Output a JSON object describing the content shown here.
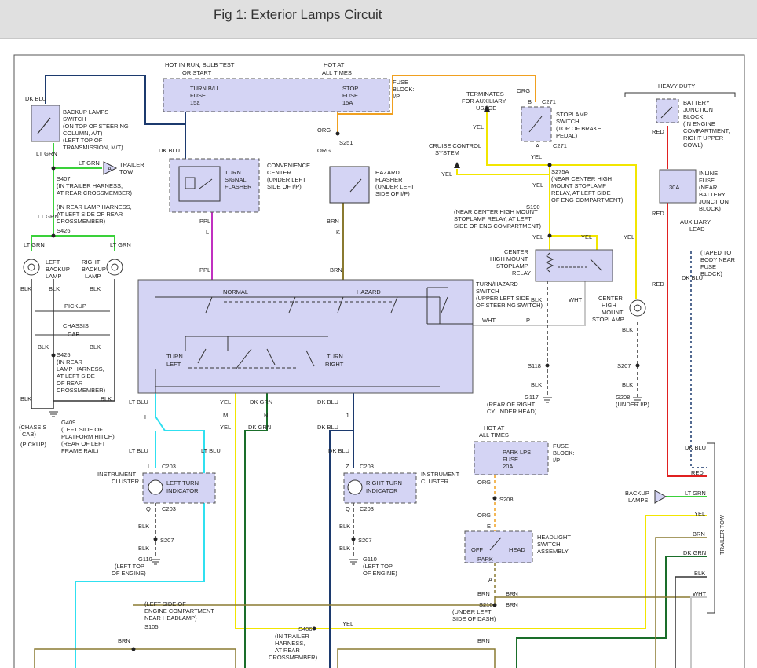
{
  "header": {
    "title": "Fig 1: Exterior Lamps Circuit"
  },
  "labels": {
    "hot_run": [
      "HOT IN RUN, BULB TEST",
      "OR START"
    ],
    "hot_all": [
      "HOT AT",
      "ALL TIMES"
    ],
    "fuse_block_ip": [
      "FUSE",
      "BLOCK:",
      "I/P"
    ],
    "turn_bu_fuse": [
      "TURN B/U",
      "FUSE",
      "15a"
    ],
    "stop_fuse": [
      "STOP",
      "FUSE",
      "15A"
    ],
    "dk_blu": "DK BLU",
    "backup_switch": [
      "BACKUP LAMPS",
      "SWITCH",
      "(ON TOP OF STEERING",
      "COLUMN, A/T)",
      "(LEFT TOP OF",
      "TRANSMISSION, M/T)"
    ],
    "lt_grn": "LT GRN",
    "trailer_tow_label": [
      "TRAILER",
      "TOW"
    ],
    "s407": [
      "S407",
      "(IN TRAILER HARNESS,",
      "AT REAR CROSSMEMBER)"
    ],
    "rear_lamp_harness": [
      "(IN REAR LAMP HARNESS,",
      "AT LEFT SIDE OF REAR",
      "CROSSMEMBER)",
      "S426"
    ],
    "left_backup_lamp": [
      "LEFT",
      "BACKUP",
      "LAMP"
    ],
    "right_backup_lamp": [
      "RIGHT",
      "BACKUP",
      "LAMP"
    ],
    "blk": "BLK",
    "pickup": "PICKUP",
    "chassis_cab": [
      "CHASSIS",
      "CAB"
    ],
    "s425": [
      "S425",
      "(IN REAR",
      "LAMP HARNESS,",
      "AT LEFT SIDE",
      "OF REAR",
      "CROSSMEMBER)"
    ],
    "g409": [
      "G409",
      "(LEFT SIDE OF",
      "PLATFORM HITCH)",
      "(REAR OF LEFT",
      "FRAME RAIL)"
    ],
    "chassis_cab_paren": [
      "(CHASSIS",
      "CAB)"
    ],
    "pickup_paren": "(PICKUP)",
    "convenience_center": [
      "CONVENIENCE",
      "CENTER",
      "(UNDER LEFT",
      "SIDE OF I/P)"
    ],
    "turn_signal_flasher": [
      "TURN",
      "SIGNAL",
      "FLASHER"
    ],
    "hazard_flasher": [
      "HAZARD",
      "FLASHER",
      "(UNDER LEFT",
      "SIDE OF I/P)"
    ],
    "org": "ORG",
    "s251": "S251",
    "brn": "BRN",
    "ppl": "PPL",
    "l_conn": "L",
    "k_conn": "K",
    "normal": "NORMAL",
    "hazard": "HAZARD",
    "turn_left": [
      "TURN",
      "LEFT"
    ],
    "turn_right": [
      "TURN",
      "RIGHT"
    ],
    "turn_hazard_switch": [
      "TURN/HAZARD",
      "SWITCH",
      "(UPPER LEFT SIDE",
      "OF STEERING SWITCH)"
    ],
    "wht": "WHT",
    "p_conn": "P",
    "terminates": [
      "TERMINATES",
      "FOR AUXILIARY",
      "USAGE"
    ],
    "cruise_control": [
      "CRUISE CONTROL",
      "SYSTEM"
    ],
    "yel": "YEL",
    "c271": "C271",
    "b_conn": "B",
    "a_conn": "A",
    "stoplamp_switch": [
      "STOPLAMP",
      "SWITCH",
      "(TOP OF BRAKE",
      "PEDAL)"
    ],
    "s275a": [
      "S275A",
      "(NEAR CENTER HIGH",
      "MOUNT STOPLAMP",
      "RELAY, AT LEFT SIDE",
      "OF ENG COMPARTMENT)"
    ],
    "s190": [
      "S190",
      "(NEAR CENTER HIGH MOUNT",
      "STOPLAMP RELAY, AT LEFT",
      "SIDE OF ENG COMPARTMENT)"
    ],
    "chms_relay": [
      "CENTER",
      "HIGH MOUNT",
      "STOPLAMP",
      "RELAY"
    ],
    "chms_lamp": [
      "CENTER",
      "HIGH",
      "MOUNT",
      "STOPLAMP"
    ],
    "s118": "S118",
    "s207": "S207",
    "g117": [
      "G117",
      "(REAR OF RIGHT",
      "CYLINDER HEAD)"
    ],
    "g208": [
      "G208",
      "(UNDER I/P)"
    ],
    "heavy_duty": "HEAVY DUTY",
    "battery_junction": [
      "BATTERY",
      "JUNCTION",
      "BLOCK",
      "(IN ENGINE",
      "COMPARTMENT,",
      "RIGHT UPPER",
      "COWL)"
    ],
    "red": "RED",
    "inline_fuse": [
      "INLINE",
      "FUSE",
      "(NEAR",
      "BATTERY",
      "JUNCTION",
      "BLOCK)"
    ],
    "fuse_30a": "30A",
    "aux_lead": [
      "AUXILIARY",
      "LEAD",
      "(TAPED TO",
      "BODY NEAR",
      "FUSE",
      "BLOCK)"
    ],
    "lt_blu": "LT BLU",
    "yel_m": "M",
    "dk_grn": "DK GRN",
    "h_conn": "H",
    "n_conn": "N",
    "j_conn": "J",
    "c203": "C203",
    "z_conn": "Z",
    "q_conn": "Q",
    "instrument_cluster": [
      "INSTRUMENT",
      "CLUSTER"
    ],
    "left_turn_ind": [
      "LEFT TURN",
      "INDICATOR"
    ],
    "right_turn_ind": [
      "RIGHT TURN",
      "INDICATOR"
    ],
    "g110": [
      "G110",
      "(LEFT TOP",
      "OF ENGINE)"
    ],
    "park_lps_fuse": [
      "PARK LPS",
      "FUSE",
      "20A"
    ],
    "s208": "S208",
    "e_conn": "E",
    "headlight_switch": [
      "HEADLIGHT",
      "SWITCH",
      "ASSEMBLY"
    ],
    "off": "OFF",
    "park": "PARK",
    "head": "HEAD",
    "s210": [
      "S210",
      "(UNDER LEFT",
      "SIDE OF DASH)"
    ],
    "backup_lamps_tow": [
      "BACKUP",
      "LAMPS"
    ],
    "trailer_tow_vert": "TRAILER TOW",
    "s105": [
      "(LEFT SIDE OF",
      "ENGINE COMPARTMENT",
      "NEAR HEADLAMP)",
      "S105"
    ],
    "s406": [
      "S406",
      "(IN TRAILER",
      "HARNESS,",
      "AT REAR",
      "CROSSMEMBER)"
    ]
  },
  "colors": {
    "dk_blu": "#1c3a6e",
    "lt_grn": "#3ad13a",
    "org": "#f0a020",
    "yel": "#f2e600",
    "ppl": "#c030c0",
    "brn": "#8a7a30",
    "red": "#e02020",
    "lt_blu": "#30e0f0",
    "dk_grn": "#1a6e2a",
    "box_fill": "#d4d4f4",
    "wht": "#c8c8c8"
  }
}
